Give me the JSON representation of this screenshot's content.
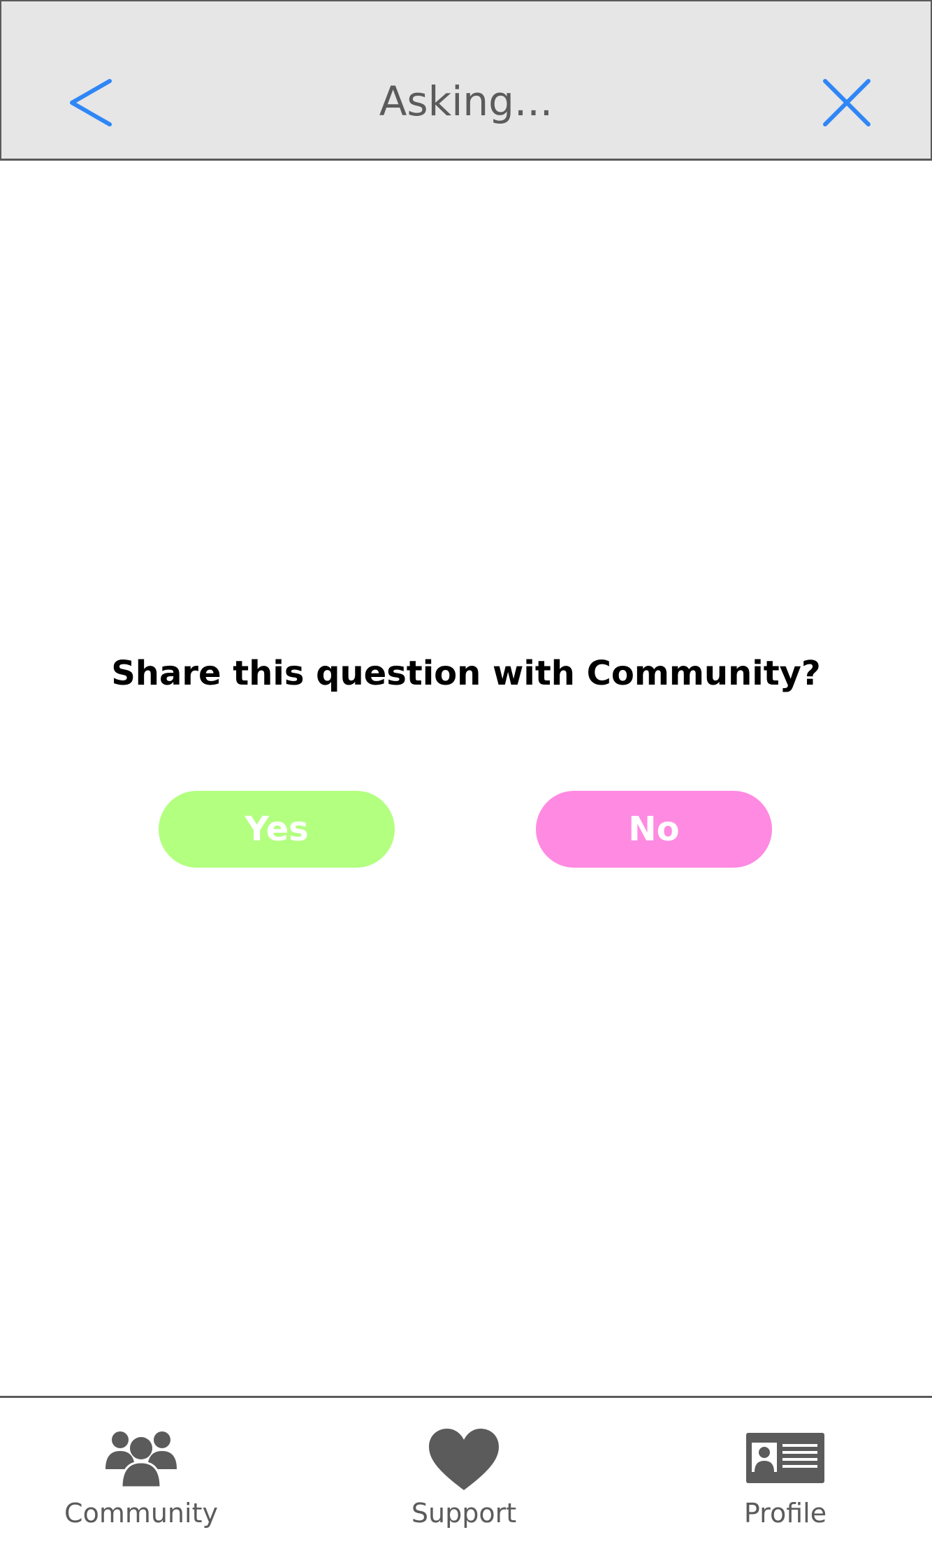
{
  "header": {
    "title": "Asking...",
    "accent_color": "#2f86f6",
    "back_icon": "chevron-left-icon",
    "close_icon": "close-icon"
  },
  "dialog": {
    "question": "Share this question with Community?",
    "yes_label": "Yes",
    "no_label": "No",
    "yes_color": "#b3ff80",
    "no_color": "#ff8ae2"
  },
  "tabbar": {
    "tabs": [
      {
        "label": "Community",
        "icon": "people-icon"
      },
      {
        "label": "Support",
        "icon": "heart-icon"
      },
      {
        "label": "Profile",
        "icon": "id-card-icon"
      }
    ],
    "icon_color": "#5b5b5b"
  }
}
